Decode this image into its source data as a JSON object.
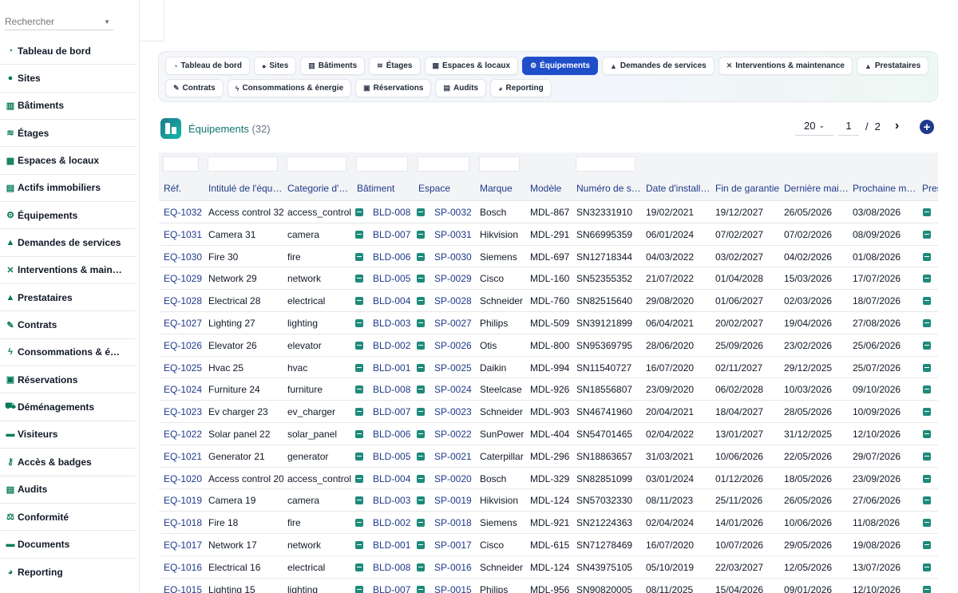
{
  "sidebar": {
    "search_placeholder": "Rechercher",
    "items": [
      {
        "label": "Tableau de bord",
        "icon": "gauge-icon",
        "glyph": "◔"
      },
      {
        "label": "Sites",
        "icon": "map-pin-icon",
        "glyph": "●"
      },
      {
        "label": "Bâtiments",
        "icon": "building-icon",
        "glyph": "▥"
      },
      {
        "label": "Étages",
        "icon": "layers-icon",
        "glyph": "≋"
      },
      {
        "label": "Espaces & locaux",
        "icon": "grid-icon",
        "glyph": "▦"
      },
      {
        "label": "Actifs immobiliers",
        "icon": "asset-icon",
        "glyph": "▤"
      },
      {
        "label": "Équipements",
        "icon": "gears-icon",
        "glyph": "⚙"
      },
      {
        "label": "Demandes de services",
        "icon": "service-icon",
        "glyph": "▲"
      },
      {
        "label": "Interventions & main…",
        "icon": "tools-icon",
        "glyph": "✕"
      },
      {
        "label": "Prestataires",
        "icon": "provider-icon",
        "glyph": "▲"
      },
      {
        "label": "Contrats",
        "icon": "contract-icon",
        "glyph": "✎"
      },
      {
        "label": "Consommations & é…",
        "icon": "bolt-icon",
        "glyph": "ϟ"
      },
      {
        "label": "Réservations",
        "icon": "calendar-icon",
        "glyph": "▣"
      },
      {
        "label": "Déménagements",
        "icon": "truck-icon",
        "glyph": "⛟"
      },
      {
        "label": "Visiteurs",
        "icon": "id-card-icon",
        "glyph": "▬"
      },
      {
        "label": "Accès & badges",
        "icon": "key-icon",
        "glyph": "⚷"
      },
      {
        "label": "Audits",
        "icon": "clipboard-icon",
        "glyph": "▤"
      },
      {
        "label": "Conformité",
        "icon": "scale-icon",
        "glyph": "⚖"
      },
      {
        "label": "Documents",
        "icon": "folder-icon",
        "glyph": "▬"
      },
      {
        "label": "Reporting",
        "icon": "chart-pie-icon",
        "glyph": "◕"
      }
    ]
  },
  "modules": {
    "row1": [
      {
        "label": "Tableau de bord",
        "glyph": "◔",
        "active": false
      },
      {
        "label": "Sites",
        "glyph": "●",
        "active": false
      },
      {
        "label": "Bâtiments",
        "glyph": "▥",
        "active": false
      },
      {
        "label": "Étages",
        "glyph": "≋",
        "active": false
      },
      {
        "label": "Espaces & locaux",
        "glyph": "▦",
        "active": false
      },
      {
        "label": "Équipements",
        "glyph": "⚙",
        "active": true
      },
      {
        "label": "Demandes de services",
        "glyph": "▲",
        "active": false
      },
      {
        "label": "Interventions & maintenance",
        "glyph": "✕",
        "active": false
      },
      {
        "label": "Prestataires",
        "glyph": "▲",
        "active": false
      }
    ],
    "row2": [
      {
        "label": "Contrats",
        "glyph": "✎",
        "active": false
      },
      {
        "label": "Consommations & énergie",
        "glyph": "ϟ",
        "active": false
      },
      {
        "label": "Réservations",
        "glyph": "▣",
        "active": false
      },
      {
        "label": "Audits",
        "glyph": "▤",
        "active": false
      },
      {
        "label": "Reporting",
        "glyph": "◕",
        "active": false
      }
    ]
  },
  "page": {
    "title": "Équipements",
    "count": "(32)"
  },
  "pagination": {
    "page_size": "20",
    "current_page": "1",
    "separator": "/",
    "total_pages": "2"
  },
  "table": {
    "columns": [
      "Réf.",
      "Intitulé de l'équ…",
      "Categorie d'…",
      "Bâtiment",
      "Espace",
      "Marque",
      "Modèle",
      "Numéro de s…",
      "Date d'install…",
      "Fin de garantie",
      "Dernière mai…",
      "Prochaine m…",
      "Pres"
    ],
    "rows": [
      [
        "EQ-1032",
        "Access control 32",
        "access_control",
        "BLD-008",
        "SP-0032",
        "Bosch",
        "MDL-867",
        "SN32331910",
        "19/02/2021",
        "19/12/2027",
        "26/05/2026",
        "03/08/2026"
      ],
      [
        "EQ-1031",
        "Camera 31",
        "camera",
        "BLD-007",
        "SP-0031",
        "Hikvision",
        "MDL-291",
        "SN66995359",
        "06/01/2024",
        "07/02/2027",
        "07/02/2026",
        "08/09/2026"
      ],
      [
        "EQ-1030",
        "Fire 30",
        "fire",
        "BLD-006",
        "SP-0030",
        "Siemens",
        "MDL-697",
        "SN12718344",
        "04/03/2022",
        "03/02/2027",
        "04/02/2026",
        "01/08/2026"
      ],
      [
        "EQ-1029",
        "Network 29",
        "network",
        "BLD-005",
        "SP-0029",
        "Cisco",
        "MDL-160",
        "SN52355352",
        "21/07/2022",
        "01/04/2028",
        "15/03/2026",
        "17/07/2026"
      ],
      [
        "EQ-1028",
        "Electrical 28",
        "electrical",
        "BLD-004",
        "SP-0028",
        "Schneider",
        "MDL-760",
        "SN82515640",
        "29/08/2020",
        "01/06/2027",
        "02/03/2026",
        "18/07/2026"
      ],
      [
        "EQ-1027",
        "Lighting 27",
        "lighting",
        "BLD-003",
        "SP-0027",
        "Philips",
        "MDL-509",
        "SN39121899",
        "06/04/2021",
        "20/02/2027",
        "19/04/2026",
        "27/08/2026"
      ],
      [
        "EQ-1026",
        "Elevator 26",
        "elevator",
        "BLD-002",
        "SP-0026",
        "Otis",
        "MDL-800",
        "SN95369795",
        "28/06/2020",
        "25/09/2026",
        "23/02/2026",
        "25/06/2026"
      ],
      [
        "EQ-1025",
        "Hvac 25",
        "hvac",
        "BLD-001",
        "SP-0025",
        "Daikin",
        "MDL-994",
        "SN11540727",
        "16/07/2020",
        "02/11/2027",
        "29/12/2025",
        "25/07/2026"
      ],
      [
        "EQ-1024",
        "Furniture 24",
        "furniture",
        "BLD-008",
        "SP-0024",
        "Steelcase",
        "MDL-926",
        "SN18556807",
        "23/09/2020",
        "06/02/2028",
        "10/03/2026",
        "09/10/2026"
      ],
      [
        "EQ-1023",
        "Ev charger 23",
        "ev_charger",
        "BLD-007",
        "SP-0023",
        "Schneider",
        "MDL-903",
        "SN46741960",
        "20/04/2021",
        "18/04/2027",
        "28/05/2026",
        "10/09/2026"
      ],
      [
        "EQ-1022",
        "Solar panel 22",
        "solar_panel",
        "BLD-006",
        "SP-0022",
        "SunPower",
        "MDL-404",
        "SN54701465",
        "02/04/2022",
        "13/01/2027",
        "31/12/2025",
        "12/10/2026"
      ],
      [
        "EQ-1021",
        "Generator 21",
        "generator",
        "BLD-005",
        "SP-0021",
        "Caterpillar",
        "MDL-296",
        "SN18863657",
        "31/03/2021",
        "10/06/2026",
        "22/05/2026",
        "29/07/2026"
      ],
      [
        "EQ-1020",
        "Access control 20",
        "access_control",
        "BLD-004",
        "SP-0020",
        "Bosch",
        "MDL-329",
        "SN82851099",
        "03/01/2024",
        "01/12/2026",
        "18/05/2026",
        "23/09/2026"
      ],
      [
        "EQ-1019",
        "Camera 19",
        "camera",
        "BLD-003",
        "SP-0019",
        "Hikvision",
        "MDL-124",
        "SN57032330",
        "08/11/2023",
        "25/11/2026",
        "26/05/2026",
        "27/06/2026"
      ],
      [
        "EQ-1018",
        "Fire 18",
        "fire",
        "BLD-002",
        "SP-0018",
        "Siemens",
        "MDL-921",
        "SN21224363",
        "02/04/2024",
        "14/01/2026",
        "10/06/2026",
        "11/08/2026"
      ],
      [
        "EQ-1017",
        "Network 17",
        "network",
        "BLD-001",
        "SP-0017",
        "Cisco",
        "MDL-615",
        "SN71278469",
        "16/07/2020",
        "10/07/2026",
        "29/05/2026",
        "19/08/2026"
      ],
      [
        "EQ-1016",
        "Electrical 16",
        "electrical",
        "BLD-008",
        "SP-0016",
        "Schneider",
        "MDL-124",
        "SN43975105",
        "05/10/2019",
        "22/03/2027",
        "12/05/2026",
        "13/07/2026"
      ],
      [
        "EQ-1015",
        "Lighting 15",
        "lighting",
        "BLD-007",
        "SP-0015",
        "Philips",
        "MDL-956",
        "SN90820005",
        "08/11/2025",
        "15/04/2026",
        "09/01/2026",
        "12/10/2026"
      ]
    ]
  }
}
